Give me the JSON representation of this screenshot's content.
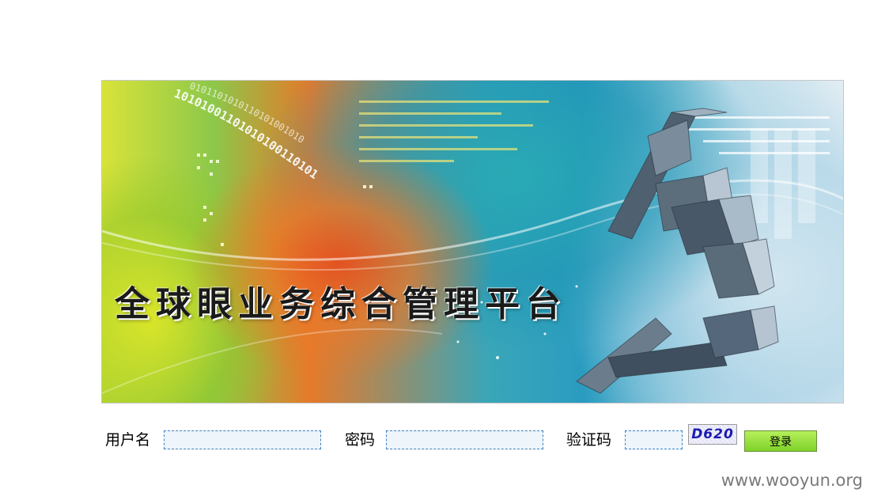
{
  "banner": {
    "title": "全球眼业务综合管理平台",
    "binary_text_1": "10101001101010100110101",
    "binary_text_2": "0101101010110101001010"
  },
  "login": {
    "username_label": "用户名",
    "username_value": "",
    "password_label": "密码",
    "password_value": "",
    "captcha_label": "验证码",
    "captcha_value": "",
    "captcha_image_text": "D620",
    "submit_label": "登录"
  },
  "watermark": "www.wooyun.org",
  "colors": {
    "field_border": "#3b7fc4",
    "field_bg": "#eef5fb",
    "button_green": "#8fdc34",
    "captcha_text": "#1b1bb0"
  }
}
